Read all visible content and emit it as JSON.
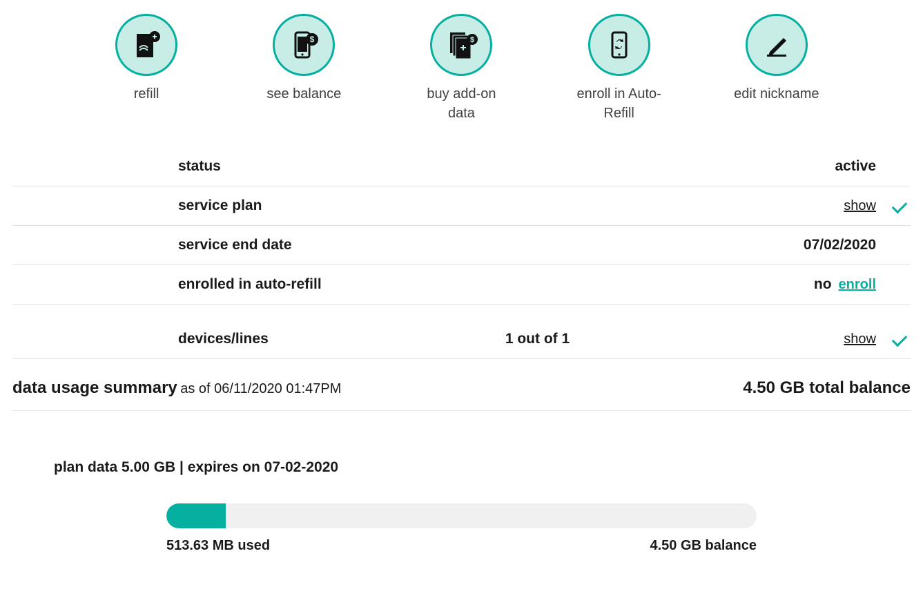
{
  "actions": {
    "refill": "refill",
    "see_balance": "see balance",
    "buy_addon": "buy add-on data",
    "enroll_auto": "enroll in Auto-Refill",
    "edit_nickname": "edit nickname"
  },
  "rows": {
    "status_label": "status",
    "status_value": "active",
    "service_plan_label": "service plan",
    "service_plan_show": "show",
    "service_end_label": "service end date",
    "service_end_value": "07/02/2020",
    "auto_refill_label": "enrolled in auto-refill",
    "auto_refill_value": "no",
    "auto_refill_enroll": "enroll",
    "devices_label": "devices/lines",
    "devices_middle": "1 out of 1",
    "devices_show": "show"
  },
  "usage": {
    "title": "data usage summary",
    "asof_prefix": "as of ",
    "asof_value": "06/11/2020 01:47PM",
    "total": "4.50 GB total balance",
    "plan_text": "plan data 5.00 GB | expires on 07-02-2020",
    "used_label": "513.63 MB used",
    "balance_label": "4.50 GB balance",
    "fill_percent": "10%"
  }
}
